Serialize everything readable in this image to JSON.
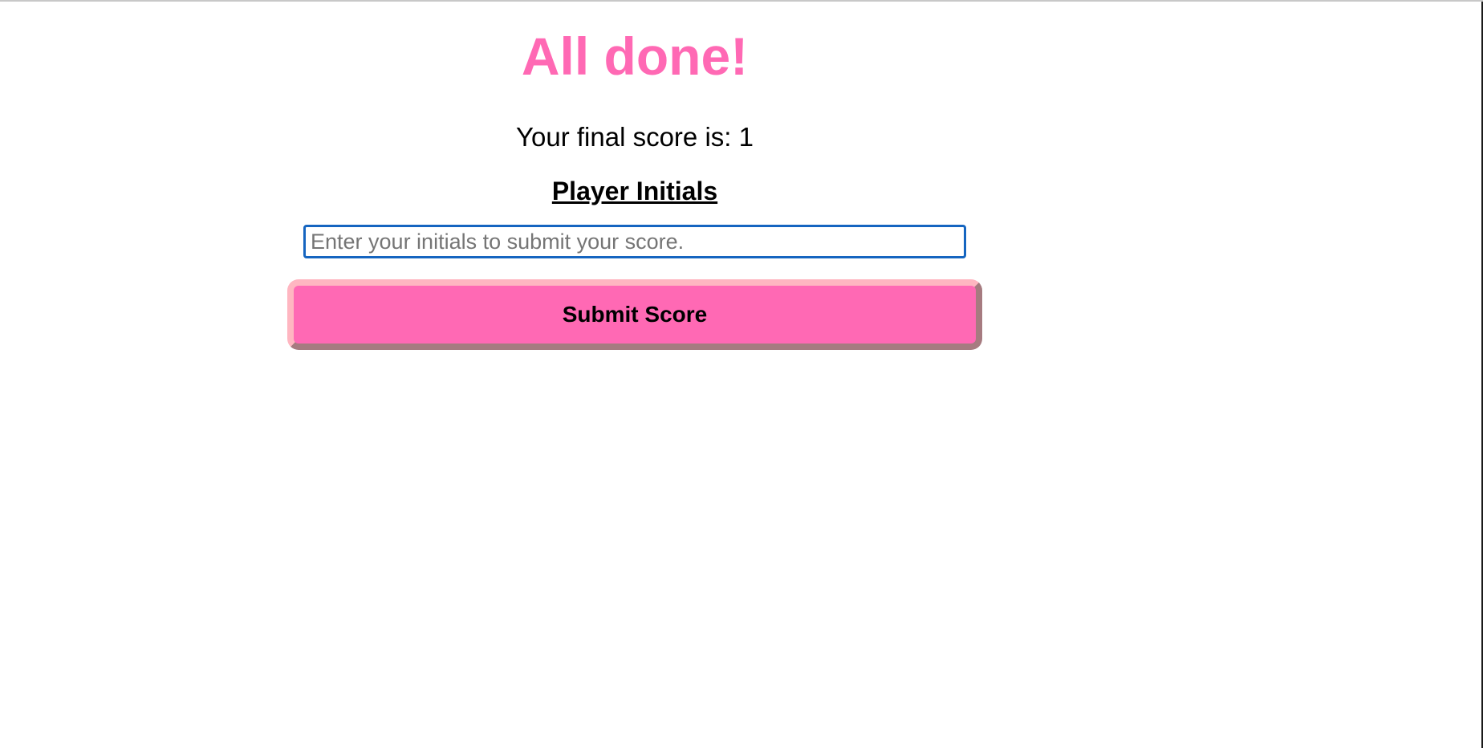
{
  "quiz_end": {
    "title": "All done!",
    "score_text": "Your final score is: 1",
    "initials_label": "Player Initials",
    "initials_input": {
      "value": "",
      "placeholder": "Enter your initials to submit your score."
    },
    "submit_label": "Submit Score"
  },
  "colors": {
    "accent": "#ff69b4",
    "button_border_light": "#ffb6c1",
    "button_border_dark": "#a67b80",
    "input_focus_border": "#1565c0"
  }
}
